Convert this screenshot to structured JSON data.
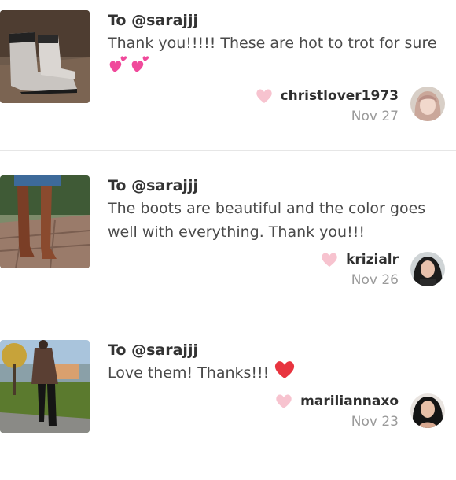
{
  "reviews": [
    {
      "to": "To @sarajjj",
      "message": "Thank you!!!!! These are hot to trot for sure",
      "message_emoji": "two-hearts-emoji x2",
      "username": "christlover1973",
      "date": "Nov 27"
    },
    {
      "to": "To @sarajjj",
      "message": "The boots are beautiful and the color goes well with everything. Thank you!!!",
      "username": "krizialr",
      "date": "Nov 26"
    },
    {
      "to": "To @sarajjj",
      "message": "Love them! Thanks!!!",
      "message_emoji": "red-heart-emoji",
      "username": "mariliannaxo",
      "date": "Nov 23"
    }
  ],
  "colors": {
    "like_heart": "#f7c3cf",
    "red_heart": "#e8343f",
    "divider": "#e6e6e6",
    "date_text": "#9a9a9a"
  }
}
